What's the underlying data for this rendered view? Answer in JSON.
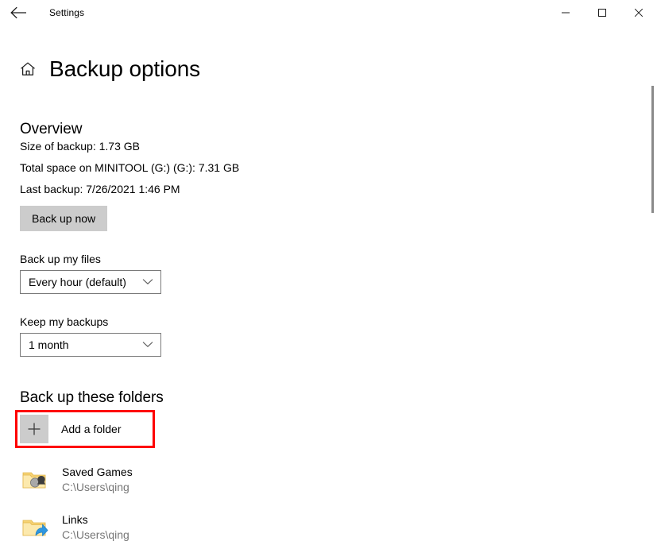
{
  "window": {
    "app_title": "Settings",
    "back_icon": "back-arrow-icon",
    "minimize_icon": "minimize-icon",
    "maximize_icon": "maximize-icon",
    "close_icon": "close-icon"
  },
  "header": {
    "home_icon": "home-icon",
    "title": "Backup options"
  },
  "overview": {
    "section_title": "Overview",
    "size_of_backup": "Size of backup: 1.73 GB",
    "total_space": "Total space on MINITOOL (G:) (G:): 7.31 GB",
    "last_backup": "Last backup: 7/26/2021 1:46 PM",
    "backup_now_label": "Back up now"
  },
  "settings_fields": [
    {
      "label": "Back up my files",
      "value": "Every hour (default)",
      "chevron_icon": "chevron-down-icon"
    },
    {
      "label": "Keep my backups",
      "value": "1 month",
      "chevron_icon": "chevron-down-icon"
    }
  ],
  "folders": {
    "section_title": "Back up these folders",
    "add_folder_label": "Add a folder",
    "add_folder_icon": "plus-icon",
    "highlight_color": "#fe0000",
    "items": [
      {
        "name": "Saved Games",
        "path": "C:\\Users\\qing",
        "icon": "saved-games-folder-icon"
      },
      {
        "name": "Links",
        "path": "C:\\Users\\qing",
        "icon": "links-folder-icon"
      }
    ]
  },
  "scrollbar": {
    "name": "vertical-scrollbar"
  }
}
